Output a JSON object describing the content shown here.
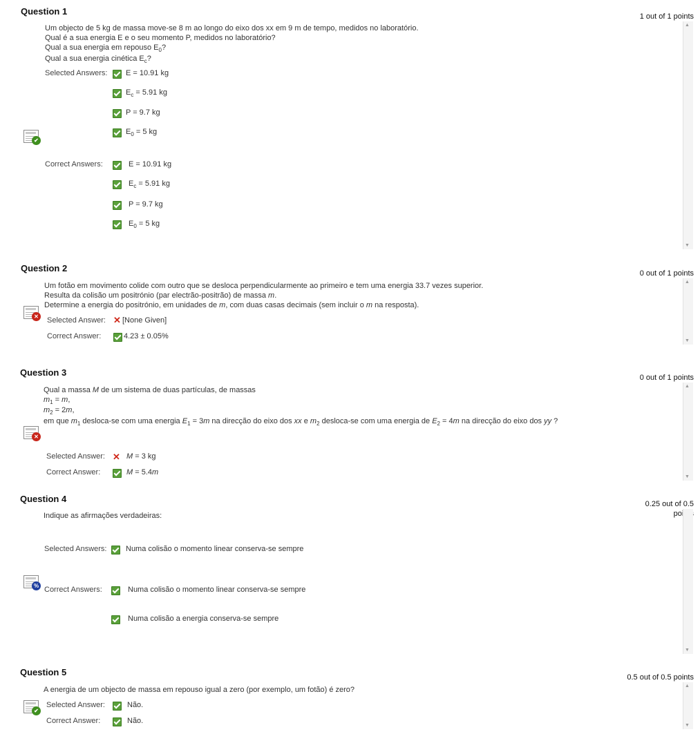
{
  "icons": {
    "correct_mark": "check-icon",
    "wrong_mark": "x-icon",
    "status_correct": "grade-correct-icon",
    "status_incorrect": "grade-incorrect-icon",
    "status_partial": "grade-partial-icon"
  },
  "colors": {
    "check": "#5aa03a",
    "wrong": "#d0291b",
    "partial_badge": "#1f3f9f"
  },
  "q1": {
    "title": "Question 1",
    "points": "1 out of 1 points",
    "text1": "Um objecto de 5 kg de massa move-se 8 m ao longo do eixo dos xx em 9 m de tempo, medidos no laboratório.",
    "text2": "Qual é a sua energia E e o seu momento P, medidos no laboratório?",
    "text3": "Qual a sua energia em repouso E",
    "text3_sub": "0",
    "text3_end": "?",
    "text4": "Qual a sua energia cinética E",
    "text4_sub": "c",
    "text4_end": "?",
    "selected_label": "Selected Answers:",
    "correct_label": "Correct Answers:",
    "a1": "E = 10.91 kg",
    "a2_pre": "E",
    "a2_sub": "c",
    "a2_post": " = 5.91 kg",
    "a3": "P = 9.7 kg",
    "a4_pre": "E",
    "a4_sub": "0",
    "a4_post": " = 5 kg"
  },
  "q2": {
    "title": "Question 2",
    "points": "0 out of 1 points",
    "text1": "Um fotão em movimento colide com outro que se desloca perpendicularmente ao primeiro e tem uma energia 33.7 vezes superior.",
    "text2_pre": "Resulta da colisão um positrónio (par electrão-positrão) de massa ",
    "text2_var": "m",
    "text2_post": ".",
    "text3_pre": "Determine a energia do positrónio, em unidades de ",
    "text3_var": "m",
    "text3_mid": ", com duas casas decimais (sem incluir o ",
    "text3_var2": "m",
    "text3_post": " na resposta).",
    "selected_label": "Selected Answer:",
    "selected_value": "[None Given]",
    "correct_label": "Correct Answer:",
    "correct_value": "4.23 ± 0.05%"
  },
  "q3": {
    "title": "Question 3",
    "points": "0 out of 1 points",
    "text1_pre": "Qual a massa ",
    "text1_var": "M",
    "text1_post": " de um sistema de duas partículas, de massas",
    "line2_var": "m",
    "line2_sub": "1",
    "line2_eq": " = ",
    "line2_val": "m",
    "line2_end": ",",
    "line3_var": "m",
    "line3_sub": "2",
    "line3_eq": " = 2",
    "line3_val": "m",
    "line3_end": ",",
    "line4_a": "em que ",
    "line4_m1": "m",
    "line4_m1_sub": "1",
    "line4_b": " desloca-se com uma energia ",
    "line4_e1": "E",
    "line4_e1_sub": "1",
    "line4_c": " = 3",
    "line4_m": "m",
    "line4_d": " na direcção do eixo dos ",
    "line4_xx": "xx",
    "line4_e": " e ",
    "line4_m2": "m",
    "line4_m2_sub": "2",
    "line4_f": " desloca-se com uma energia de ",
    "line4_e2": "E",
    "line4_e2_sub": "2",
    "line4_g": " = 4",
    "line4_m3": "m",
    "line4_h": " na direcção do eixo dos ",
    "line4_yy": "yy",
    "line4_i": " ?",
    "selected_label": "Selected Answer:",
    "selected_var": "M",
    "selected_val": " = 3 kg",
    "correct_label": "Correct Answer:",
    "correct_var": "M",
    "correct_val": " = 5.4",
    "correct_m": "m"
  },
  "q4": {
    "title": "Question 4",
    "points_line1": "0.25 out of 0.5",
    "points_line2": "points",
    "text1": "Indique as afirmações verdadeiras:",
    "selected_label": "Selected Answers:",
    "selected_1": "Numa colisão o momento linear conserva-se sempre",
    "correct_label": "Correct Answers:",
    "correct_1": "Numa colisão o momento linear conserva-se sempre",
    "correct_2": "Numa colisão a energia conserva-se sempre"
  },
  "q5": {
    "title": "Question 5",
    "points": "0.5 out of 0.5 points",
    "text1": "A energia de um objecto de massa em repouso igual a zero (por exemplo, um fotão) é zero?",
    "selected_label": "Selected Answer:",
    "selected_value": "Não.",
    "correct_label": "Correct Answer:",
    "correct_value": "Não."
  }
}
